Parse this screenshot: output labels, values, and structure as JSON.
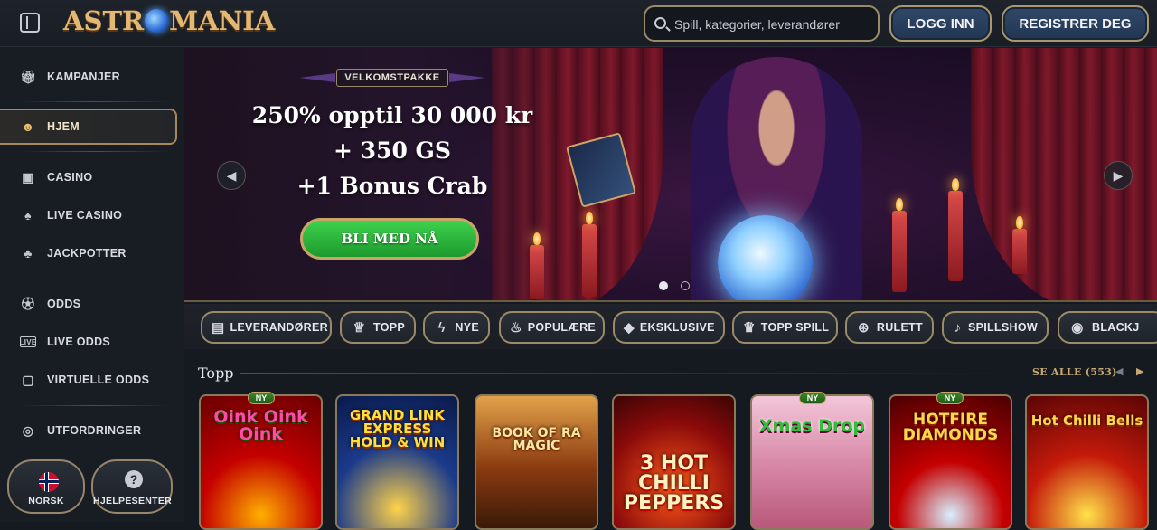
{
  "header": {
    "logo_text_left": "ASTR",
    "logo_text_right": "MANIA",
    "search_placeholder": "Spill, kategorier, leverandører",
    "login_label": "LOGG INN",
    "register_label": "REGISTRER DEG"
  },
  "sidebar": {
    "items": [
      {
        "label": "KAMPANJER",
        "icon": "gift-icon"
      },
      {
        "label": "HJEM",
        "icon": "home-icon"
      },
      {
        "label": "CASINO",
        "icon": "slot-machine-icon"
      },
      {
        "label": "LIVE CASINO",
        "icon": "playing-card-icon"
      },
      {
        "label": "JACKPOTTER",
        "icon": "clover-icon"
      },
      {
        "label": "ODDS",
        "icon": "football-icon"
      },
      {
        "label": "LIVE ODDS",
        "icon": "live-badge-icon"
      },
      {
        "label": "VIRTUELLE ODDS",
        "icon": "virtual-screen-icon"
      },
      {
        "label": "UTFORDRINGER",
        "icon": "medal-icon"
      }
    ],
    "language_label": "NORSK",
    "help_label": "HJELPESENTER"
  },
  "banner": {
    "badge": "VELKOMSTPAKKE",
    "line1": "250% opptil 30 000 kr",
    "line2": "+ 350 GS",
    "line3": "+1 Bonus Crab",
    "cta_label": "BLI MED NÅ"
  },
  "categories": [
    {
      "label": "LEVERANDØRER",
      "icon": "providers-icon"
    },
    {
      "label": "TOPP",
      "icon": "trophy-icon"
    },
    {
      "label": "NYE",
      "icon": "lightning-icon"
    },
    {
      "label": "POPULÆRE",
      "icon": "flame-icon"
    },
    {
      "label": "EKSKLUSIVE",
      "icon": "diamond-icon"
    },
    {
      "label": "TOPP SPILL",
      "icon": "crown-icon"
    },
    {
      "label": "RULETT",
      "icon": "roulette-icon"
    },
    {
      "label": "SPILLSHOW",
      "icon": "microphone-icon"
    },
    {
      "label": "BLACKJ",
      "icon": "chips-icon"
    }
  ],
  "games_section": {
    "title": "Topp",
    "see_all": "SE ALLE (553)",
    "new_tag": "NY",
    "games": [
      {
        "title": "Oink Oink Oink"
      },
      {
        "title": "GRAND LINK EXPRESS HOLD & WIN"
      },
      {
        "title": "BOOK OF RA MAGIC"
      },
      {
        "title": "3 HOT CHILLI PEPPERS"
      },
      {
        "title": "Xmas Drop"
      },
      {
        "title": "HOTFIRE DIAMONDS"
      },
      {
        "title": "Hot Chilli Bells"
      }
    ]
  }
}
